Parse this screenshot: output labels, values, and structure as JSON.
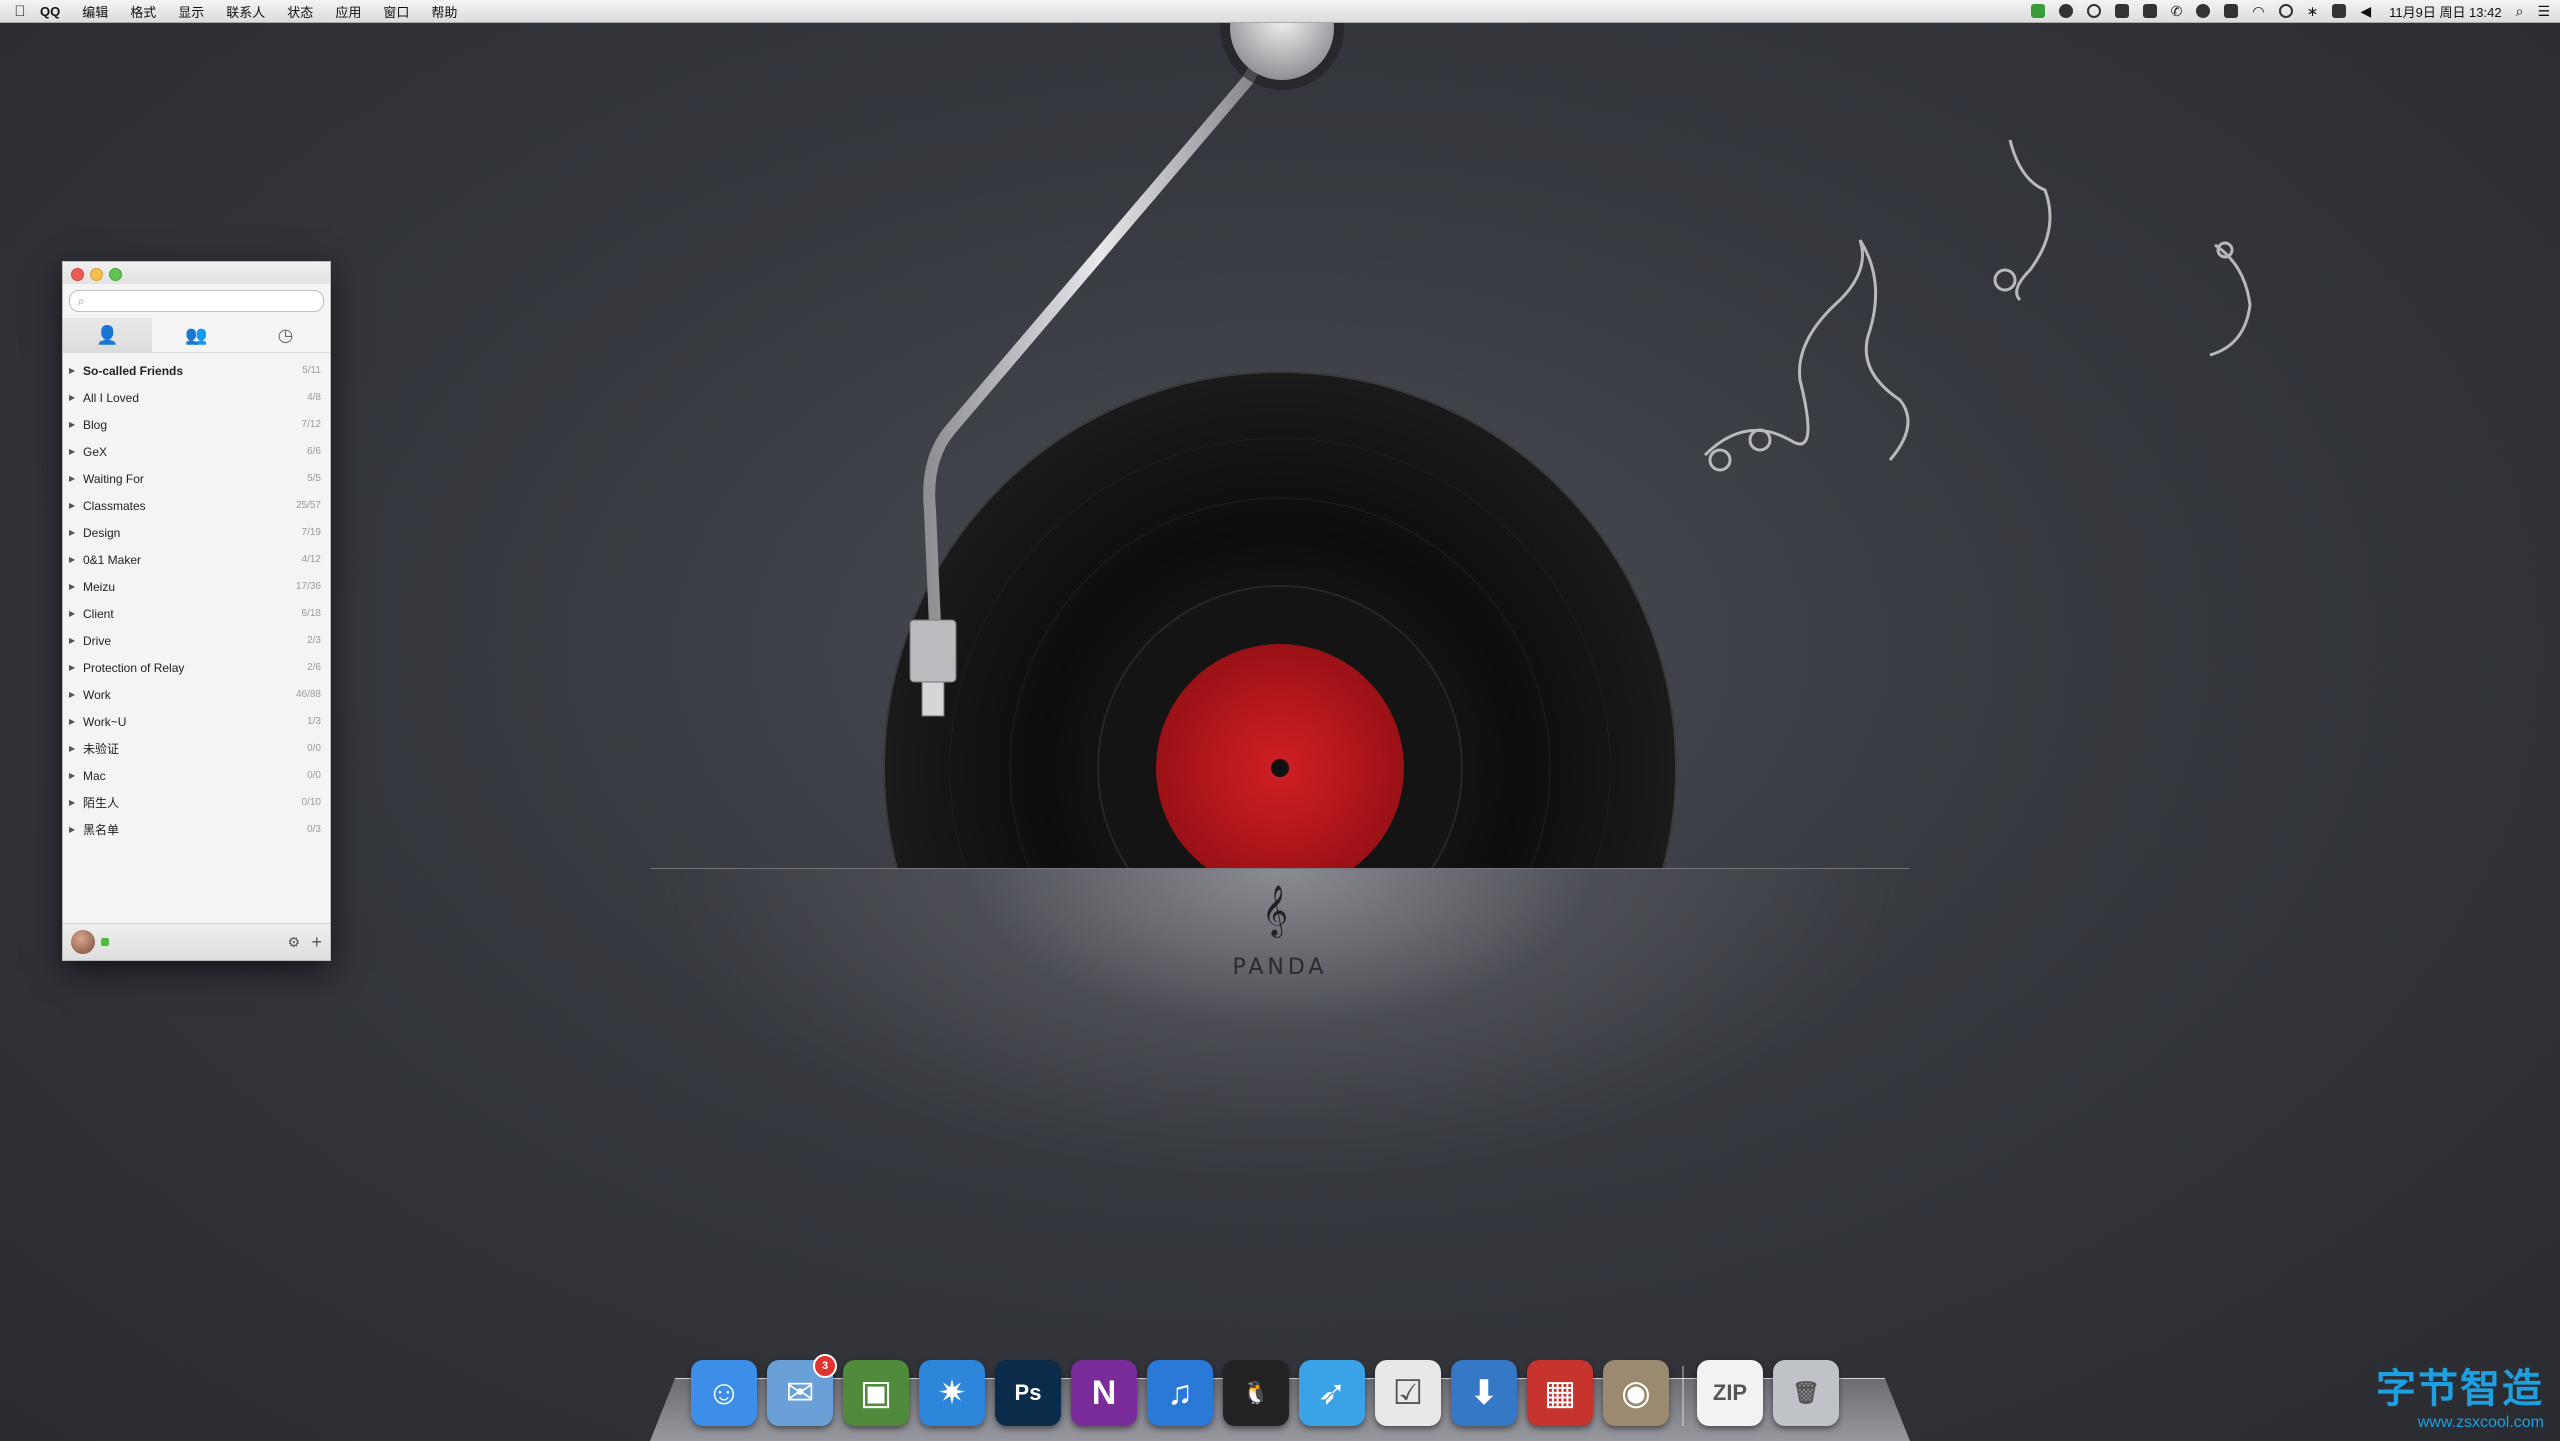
{
  "menubar": {
    "apple": "",
    "app_name": "QQ",
    "items": [
      "编辑",
      "格式",
      "显示",
      "联系人",
      "状态",
      "应用",
      "窗口",
      "帮助"
    ],
    "clock": "11月9日 周日 13:42"
  },
  "wallpaper": {
    "logo_text": "PANDA",
    "logo_symbol": "𝄞",
    "colors": {
      "record": "#0c0c0c",
      "label": "#c0161b",
      "background": "#3a3c42"
    }
  },
  "qq_window": {
    "search_placeholder": "",
    "tabs": [
      "contacts-icon",
      "groups-icon",
      "recent-icon"
    ],
    "groups": [
      {
        "label": "So-called Friends",
        "count": "5/11"
      },
      {
        "label": "All I Loved",
        "count": "4/8"
      },
      {
        "label": "Blog",
        "count": "7/12"
      },
      {
        "label": "GeX",
        "count": "6/6"
      },
      {
        "label": "Waiting For",
        "count": "5/5"
      },
      {
        "label": "Classmates",
        "count": "25/57"
      },
      {
        "label": "Design",
        "count": "7/19"
      },
      {
        "label": "0&1 Maker",
        "count": "4/12"
      },
      {
        "label": "Meizu",
        "count": "17/36"
      },
      {
        "label": "Client",
        "count": "6/18"
      },
      {
        "label": "Drive",
        "count": "2/3"
      },
      {
        "label": "Protection of Relay",
        "count": "2/6"
      },
      {
        "label": "Work",
        "count": "46/88"
      },
      {
        "label": "Work~U",
        "count": "1/3"
      },
      {
        "label": "未验证",
        "count": "0/0"
      },
      {
        "label": "Mac",
        "count": "0/0"
      },
      {
        "label": "陌生人",
        "count": "0/10"
      },
      {
        "label": "黑名单",
        "count": "0/3"
      }
    ]
  },
  "dock": {
    "items": [
      {
        "name": "finder-icon",
        "glyph": "☺",
        "color": "#3d8ee8"
      },
      {
        "name": "mail-icon",
        "glyph": "✉",
        "color": "#6aa0d8",
        "badge": "3"
      },
      {
        "name": "iphoto-icon",
        "glyph": "▣",
        "color": "#4f8b3a"
      },
      {
        "name": "safari-icon",
        "glyph": "✷",
        "color": "#2d86d9"
      },
      {
        "name": "photoshop-icon",
        "glyph": "Ps",
        "color": "#0b2b4a"
      },
      {
        "name": "onenote-icon",
        "glyph": "N",
        "color": "#7b2c9b"
      },
      {
        "name": "itunes-icon",
        "glyph": "♫",
        "color": "#2a79d6"
      },
      {
        "name": "qq-icon",
        "glyph": "🐧",
        "color": "#222222"
      },
      {
        "name": "twitter-bird-icon",
        "glyph": "➶",
        "color": "#3aa2e6"
      },
      {
        "name": "todo-icon",
        "glyph": "☑",
        "color": "#e8e8e8"
      },
      {
        "name": "downloads-icon",
        "glyph": "⬇",
        "color": "#3579c6"
      },
      {
        "name": "parallels-icon",
        "glyph": "▦",
        "color": "#c7332d"
      },
      {
        "name": "preview-icon",
        "glyph": "◉",
        "color": "#9b8a6f"
      },
      {
        "name": "zip-file-icon",
        "glyph": "ZIP",
        "color": "#f2f2f2"
      },
      {
        "name": "trash-icon",
        "glyph": "🗑",
        "color": "#bfc3c7"
      }
    ]
  },
  "watermark": {
    "title": "字节智造",
    "url": "www.zsxcool.com"
  }
}
